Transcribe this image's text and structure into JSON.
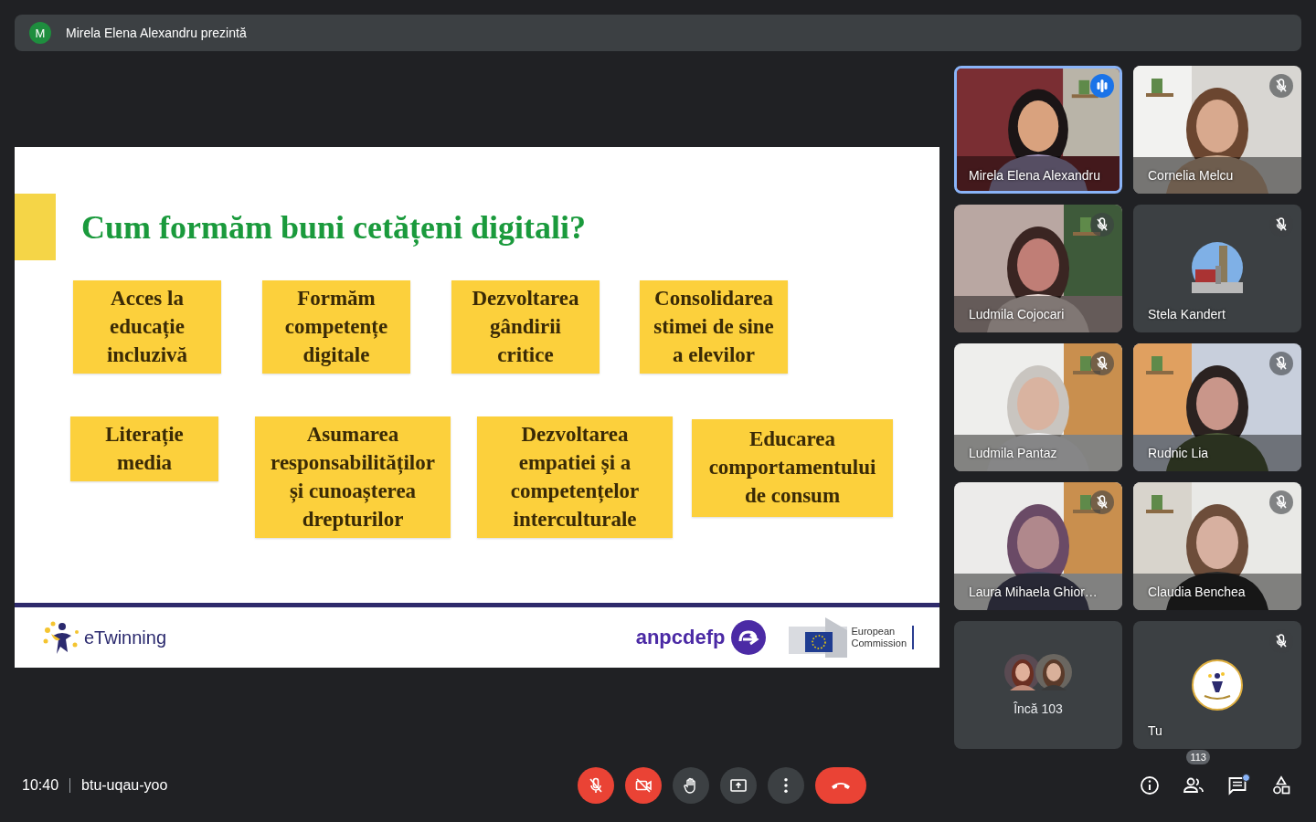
{
  "presenter_bar": {
    "initial": "M",
    "text": "Mirela Elena Alexandru prezintă"
  },
  "slide": {
    "title": "Cum formăm buni cetățeni digitali?",
    "rows": [
      [
        "Acces la\neducație\nincluzivă",
        "Formăm\ncompetențe\ndigitale",
        "Dezvoltarea\ngândirii\ncritice",
        "Consolidarea\nstimei de sine\na elevilor"
      ],
      [
        "Literație\nmedia",
        "Asumarea\nresponsabilităților\nși cunoașterea\ndrepturilor",
        "Dezvoltarea\nempatiei și a\ncompetențelor\ninterculturale",
        "Educarea\ncomportamentului\nde consum"
      ]
    ],
    "footer": {
      "etwinning": "eTwinning",
      "agency": "anpcdefp",
      "commission": "European\nCommission"
    }
  },
  "tiles": [
    {
      "kind": "video",
      "name": "Mirela Elena Alexandru",
      "speaking": true,
      "muted": false
    },
    {
      "kind": "video",
      "name": "Cornelia Melcu",
      "speaking": false,
      "muted": true
    },
    {
      "kind": "video",
      "name": "Ludmila Cojocari",
      "speaking": false,
      "muted": true
    },
    {
      "kind": "avatar",
      "name": "Stela Kandert",
      "speaking": false,
      "muted": true
    },
    {
      "kind": "video",
      "name": "Ludmila Pantaz",
      "speaking": false,
      "muted": true
    },
    {
      "kind": "video",
      "name": "Rudnic Lia",
      "speaking": false,
      "muted": true
    },
    {
      "kind": "video",
      "name": "Laura Mihaela Ghior…",
      "speaking": false,
      "muted": true
    },
    {
      "kind": "video",
      "name": "Claudia Benchea",
      "speaking": false,
      "muted": true
    },
    {
      "kind": "more",
      "name": "Încă 103",
      "speaking": false,
      "muted": false
    },
    {
      "kind": "self",
      "name": "Tu",
      "speaking": false,
      "muted": true
    }
  ],
  "bottom_bar": {
    "time": "10:40",
    "meeting_code": "btu-uqau-yoo",
    "controls": [
      {
        "kind": "mic",
        "on": false
      },
      {
        "kind": "camera",
        "on": false
      },
      {
        "kind": "hand"
      },
      {
        "kind": "present"
      },
      {
        "kind": "more"
      },
      {
        "kind": "leave"
      }
    ],
    "side": [
      {
        "kind": "info"
      },
      {
        "kind": "people",
        "badge": "113"
      },
      {
        "kind": "chat",
        "unread": true
      },
      {
        "kind": "activities"
      }
    ]
  }
}
